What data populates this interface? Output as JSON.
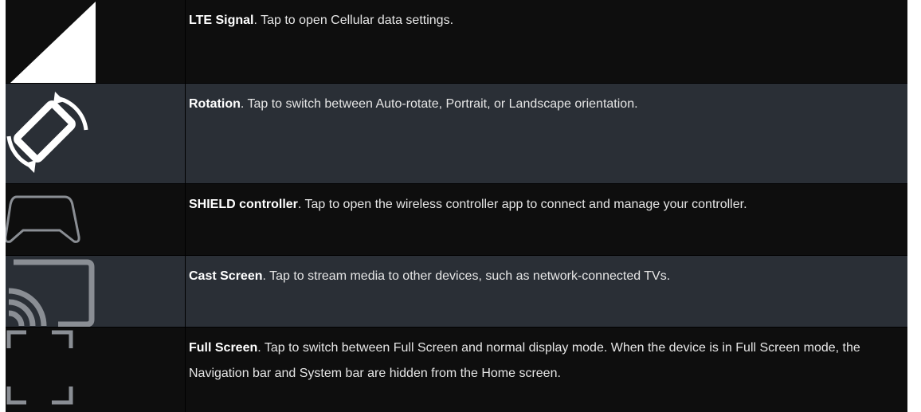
{
  "rows": [
    {
      "icon": "signal-icon",
      "title": "LTE Signal",
      "description": ". Tap to open Cellular data settings."
    },
    {
      "icon": "rotation-icon",
      "title": "Rotation",
      "description": ". Tap to switch between Auto-rotate, Portrait, or Landscape orientation."
    },
    {
      "icon": "controller-icon",
      "title": "SHIELD controller",
      "description": ". Tap to open the wireless controller app to connect and manage your controller."
    },
    {
      "icon": "cast-icon",
      "title": "Cast Screen",
      "description": ". Tap to stream media to other devices, such as network-connected TVs."
    },
    {
      "icon": "fullscreen-icon",
      "title": "Full Screen",
      "description": ". Tap to switch between Full Screen and normal display mode. When the device is in Full Screen mode, the Navigation bar and System bar are hidden from the Home screen."
    }
  ]
}
